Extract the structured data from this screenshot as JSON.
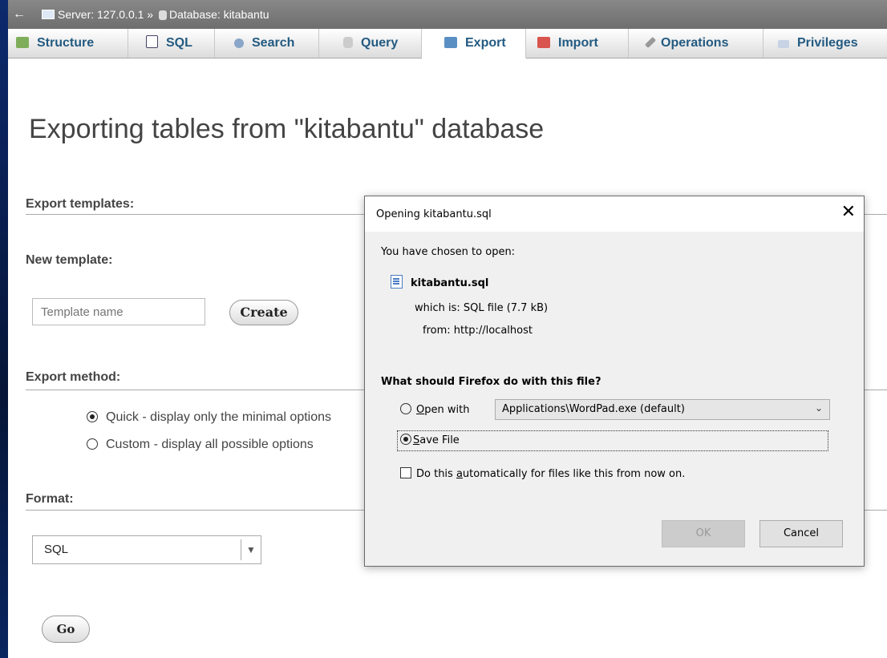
{
  "breadcrumb": {
    "back": "←",
    "server": "Server: 127.0.0.1",
    "separator": "»",
    "database": "Database: kitabantu"
  },
  "tabs": [
    {
      "label": "Structure",
      "icon": "structure-icon"
    },
    {
      "label": "SQL",
      "icon": "sql-icon"
    },
    {
      "label": "Search",
      "icon": "search-icon"
    },
    {
      "label": "Query",
      "icon": "query-icon"
    },
    {
      "label": "Export",
      "icon": "export-icon",
      "active": true
    },
    {
      "label": "Import",
      "icon": "import-icon"
    },
    {
      "label": "Operations",
      "icon": "operations-icon"
    },
    {
      "label": "Privileges",
      "icon": "privileges-icon"
    }
  ],
  "page": {
    "title": "Exporting tables from \"kitabantu\" database",
    "export_templates_heading": "Export templates:",
    "new_template_label": "New template:",
    "template_placeholder": "Template name",
    "create_button": "Create",
    "export_method_heading": "Export method:",
    "method_quick": "Quick - display only the minimal options",
    "method_custom": "Custom - display all possible options",
    "format_heading": "Format:",
    "format_value": "SQL",
    "go_button": "Go"
  },
  "dialog": {
    "title": "Opening kitabantu.sql",
    "close": "✕",
    "intro": "You have chosen to open:",
    "filename": "kitabantu.sql",
    "which_is_label": "which is:",
    "which_is_value": "SQL file (7.7 kB)",
    "from_label": "from:",
    "from_value": "http://localhost",
    "question": "What should Firefox do with this file?",
    "open_with_prefix": "O",
    "open_with_rest": "pen with",
    "open_with_app": "Applications\\WordPad.exe (default)",
    "save_prefix": "S",
    "save_rest": "ave File",
    "auto_before": "Do this ",
    "auto_key": "a",
    "auto_after": "utomatically for files like this from now on.",
    "ok_button": "OK",
    "cancel_button": "Cancel"
  },
  "colors": {
    "tab_text": "#235a81",
    "topbar": "#7a7a7a"
  }
}
